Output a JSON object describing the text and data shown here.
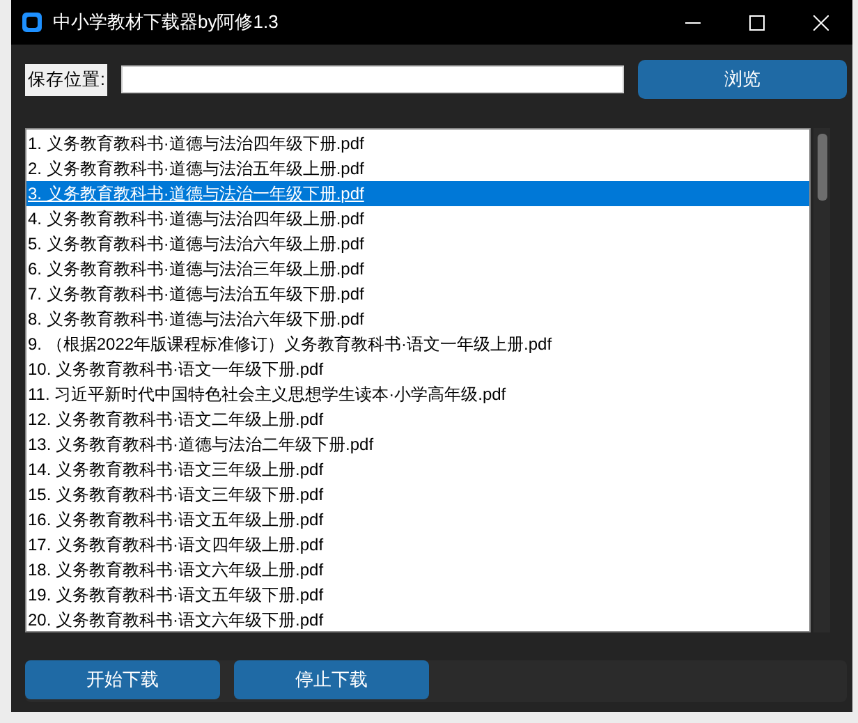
{
  "window": {
    "title": "中小学教材下载器by阿修1.3"
  },
  "save_location": {
    "label": "保存位置:"
  },
  "browse_button": "浏览",
  "files": [
    {
      "label": "1. 义务教育教科书·道德与法治四年级下册.pdf",
      "selected": false
    },
    {
      "label": "2. 义务教育教科书·道德与法治五年级上册.pdf",
      "selected": false
    },
    {
      "label": "3. 义务教育教科书·道德与法治一年级下册.pdf",
      "selected": true
    },
    {
      "label": "4. 义务教育教科书·道德与法治四年级上册.pdf",
      "selected": false
    },
    {
      "label": "5. 义务教育教科书·道德与法治六年级上册.pdf",
      "selected": false
    },
    {
      "label": "6. 义务教育教科书·道德与法治三年级上册.pdf",
      "selected": false
    },
    {
      "label": "7. 义务教育教科书·道德与法治五年级下册.pdf",
      "selected": false
    },
    {
      "label": "8. 义务教育教科书·道德与法治六年级下册.pdf",
      "selected": false
    },
    {
      "label": "9. （根据2022年版课程标准修订）义务教育教科书·语文一年级上册.pdf",
      "selected": false
    },
    {
      "label": "10. 义务教育教科书·语文一年级下册.pdf",
      "selected": false
    },
    {
      "label": "11. 习近平新时代中国特色社会主义思想学生读本·小学高年级.pdf",
      "selected": false
    },
    {
      "label": "12. 义务教育教科书·语文二年级上册.pdf",
      "selected": false
    },
    {
      "label": "13. 义务教育教科书·道德与法治二年级下册.pdf",
      "selected": false
    },
    {
      "label": "14. 义务教育教科书·语文三年级上册.pdf",
      "selected": false
    },
    {
      "label": "15. 义务教育教科书·语文三年级下册.pdf",
      "selected": false
    },
    {
      "label": "16. 义务教育教科书·语文五年级上册.pdf",
      "selected": false
    },
    {
      "label": "17. 义务教育教科书·语文四年级上册.pdf",
      "selected": false
    },
    {
      "label": "18. 义务教育教科书·语文六年级上册.pdf",
      "selected": false
    },
    {
      "label": "19. 义务教育教科书·语文五年级下册.pdf",
      "selected": false
    },
    {
      "label": "20. 义务教育教科书·语文六年级下册.pdf",
      "selected": false
    }
  ],
  "actions": [
    "开始下载",
    "停止下载"
  ]
}
